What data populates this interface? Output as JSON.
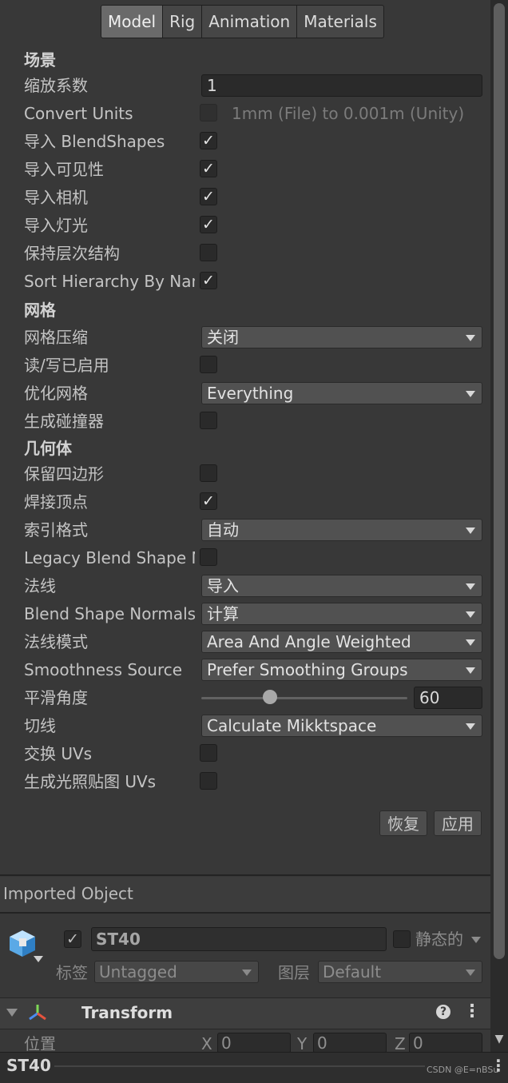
{
  "tabs": [
    "Model",
    "Rig",
    "Animation",
    "Materials"
  ],
  "active_tab": "Model",
  "scene": {
    "heading": "场景",
    "scale_factor_label": "缩放系数",
    "scale_factor_value": "1",
    "convert_units_label": "Convert Units",
    "convert_units_hint": "1mm (File) to 0.001m (Unity)",
    "import_blendshapes_label": "导入 BlendShapes",
    "import_visibility_label": "导入可见性",
    "import_cameras_label": "导入相机",
    "import_lights_label": "导入灯光",
    "preserve_hierarchy_label": "保持层次结构",
    "sort_hierarchy_label": "Sort Hierarchy By Name"
  },
  "meshes": {
    "heading": "网格",
    "mesh_compression_label": "网格压缩",
    "mesh_compression_value": "关闭",
    "read_write_label": "读/写已启用",
    "optimize_mesh_label": "优化网格",
    "optimize_mesh_value": "Everything",
    "generate_colliders_label": "生成碰撞器"
  },
  "geometry": {
    "heading": "几何体",
    "keep_quads_label": "保留四边形",
    "weld_vertices_label": "焊接顶点",
    "index_format_label": "索引格式",
    "index_format_value": "自动",
    "legacy_blend_label": "Legacy Blend Shape Normals",
    "normals_label": "法线",
    "normals_value": "导入",
    "blend_shape_normals_label": "Blend Shape Normals",
    "blend_shape_normals_value": "计算",
    "normals_mode_label": "法线模式",
    "normals_mode_value": "Area And Angle Weighted",
    "smoothness_source_label": "Smoothness Source",
    "smoothness_source_value": "Prefer Smoothing Groups",
    "smoothing_angle_label": "平滑角度",
    "smoothing_angle_value": "60",
    "smoothing_angle_fraction": 0.333,
    "tangents_label": "切线",
    "tangents_value": "Calculate Mikktspace",
    "swap_uvs_label": "交换 UVs",
    "lightmap_uvs_label": "生成光照贴图 UVs"
  },
  "checkbox_states": {
    "convert_units": false,
    "import_blendshapes": true,
    "import_visibility": true,
    "import_cameras": true,
    "import_lights": true,
    "preserve_hierarchy": false,
    "sort_hierarchy": true,
    "read_write": false,
    "generate_colliders": false,
    "keep_quads": false,
    "weld_vertices": true,
    "legacy_blend": false,
    "swap_uvs": false,
    "lightmap_uvs": false
  },
  "buttons": {
    "revert": "恢复",
    "apply": "应用"
  },
  "imported_object": {
    "heading": "Imported Object",
    "name": "ST40",
    "static_label": "静态的",
    "tag_label": "标签",
    "tag_value": "Untagged",
    "layer_label": "图层",
    "layer_value": "Default"
  },
  "transform": {
    "title": "Transform",
    "position_label": "位置",
    "x_label": "X",
    "y_label": "Y",
    "z_label": "Z",
    "x_value": "0",
    "y_value": "0",
    "z_value": "0"
  },
  "status_bar": {
    "title": "ST40",
    "watermark": "CSDN @E=nBSu"
  },
  "colors": {
    "background": "#383838",
    "field_bg": "#2a2a2a",
    "dropdown_bg": "#515151",
    "active_tab_bg": "#6a6a6a"
  }
}
